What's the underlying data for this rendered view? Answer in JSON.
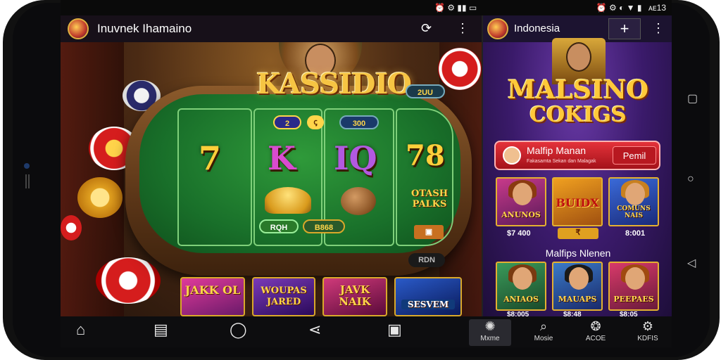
{
  "status_bar": {
    "left_icons": "⏰ ⚙ ▮▮ ▭",
    "right_icons": "⏰ ⚙ ◐ ▼ ▮",
    "time": "ᴀᴇ13"
  },
  "left_app": {
    "title": "Inuvnek Ihamaino",
    "sync_icon": "⟳",
    "menu_icon": "⋮",
    "logo_title": "KASSIDIO",
    "badge_top_right": "2UU",
    "card_symbols": [
      "7",
      "K",
      "IQ",
      "78"
    ],
    "pill_bet": "2",
    "pill_bet_icon": "ꞔ",
    "pill_value": "300",
    "pill_green_1": "RQH",
    "pill_green_2": "B868",
    "side_text": "OTASH PALKS",
    "side_button": "▣",
    "rail_label": "RDN",
    "game_tiles": [
      "JAKK OL",
      "WOUPAS JARED",
      "JAVK NAIK",
      "SESVEM"
    ]
  },
  "right_app": {
    "title": "Indonesia",
    "add_icon": "+",
    "menu_icon": "⋮",
    "logo_line1": "MALSINO",
    "logo_line2": "COKIGS",
    "user_name": "Malfip Manan",
    "user_sub": "Fakasamta Sekan dan Malagak",
    "user_button": "Pemil",
    "tiles_row1": [
      {
        "label": "ANUNOS",
        "value": "$7 400"
      },
      {
        "label": "BUIDX",
        "value": "₹"
      },
      {
        "label": "COMUNS NAIS",
        "value": "8:001"
      }
    ],
    "section_title": "Malfips Nlenen",
    "tiles_row2": [
      {
        "label": "ANIAOS",
        "value": "$8:005"
      },
      {
        "label": "MAUAPS",
        "value": "$8:48"
      },
      {
        "label": "PEEPAES",
        "value": "$8:05"
      }
    ]
  },
  "bottom_nav": {
    "left_icons": [
      "⌂",
      "▤",
      "◯",
      "⋖",
      "▣"
    ],
    "right_items": [
      {
        "icon": "✺",
        "label": "Mxme"
      },
      {
        "icon": "⌕",
        "label": "Mosie"
      },
      {
        "icon": "❂",
        "label": "ACOE"
      },
      {
        "icon": "⚙",
        "label": "KDFIS"
      }
    ]
  },
  "system_buttons": {
    "recent": "▢",
    "home": "○",
    "back": "◁"
  }
}
